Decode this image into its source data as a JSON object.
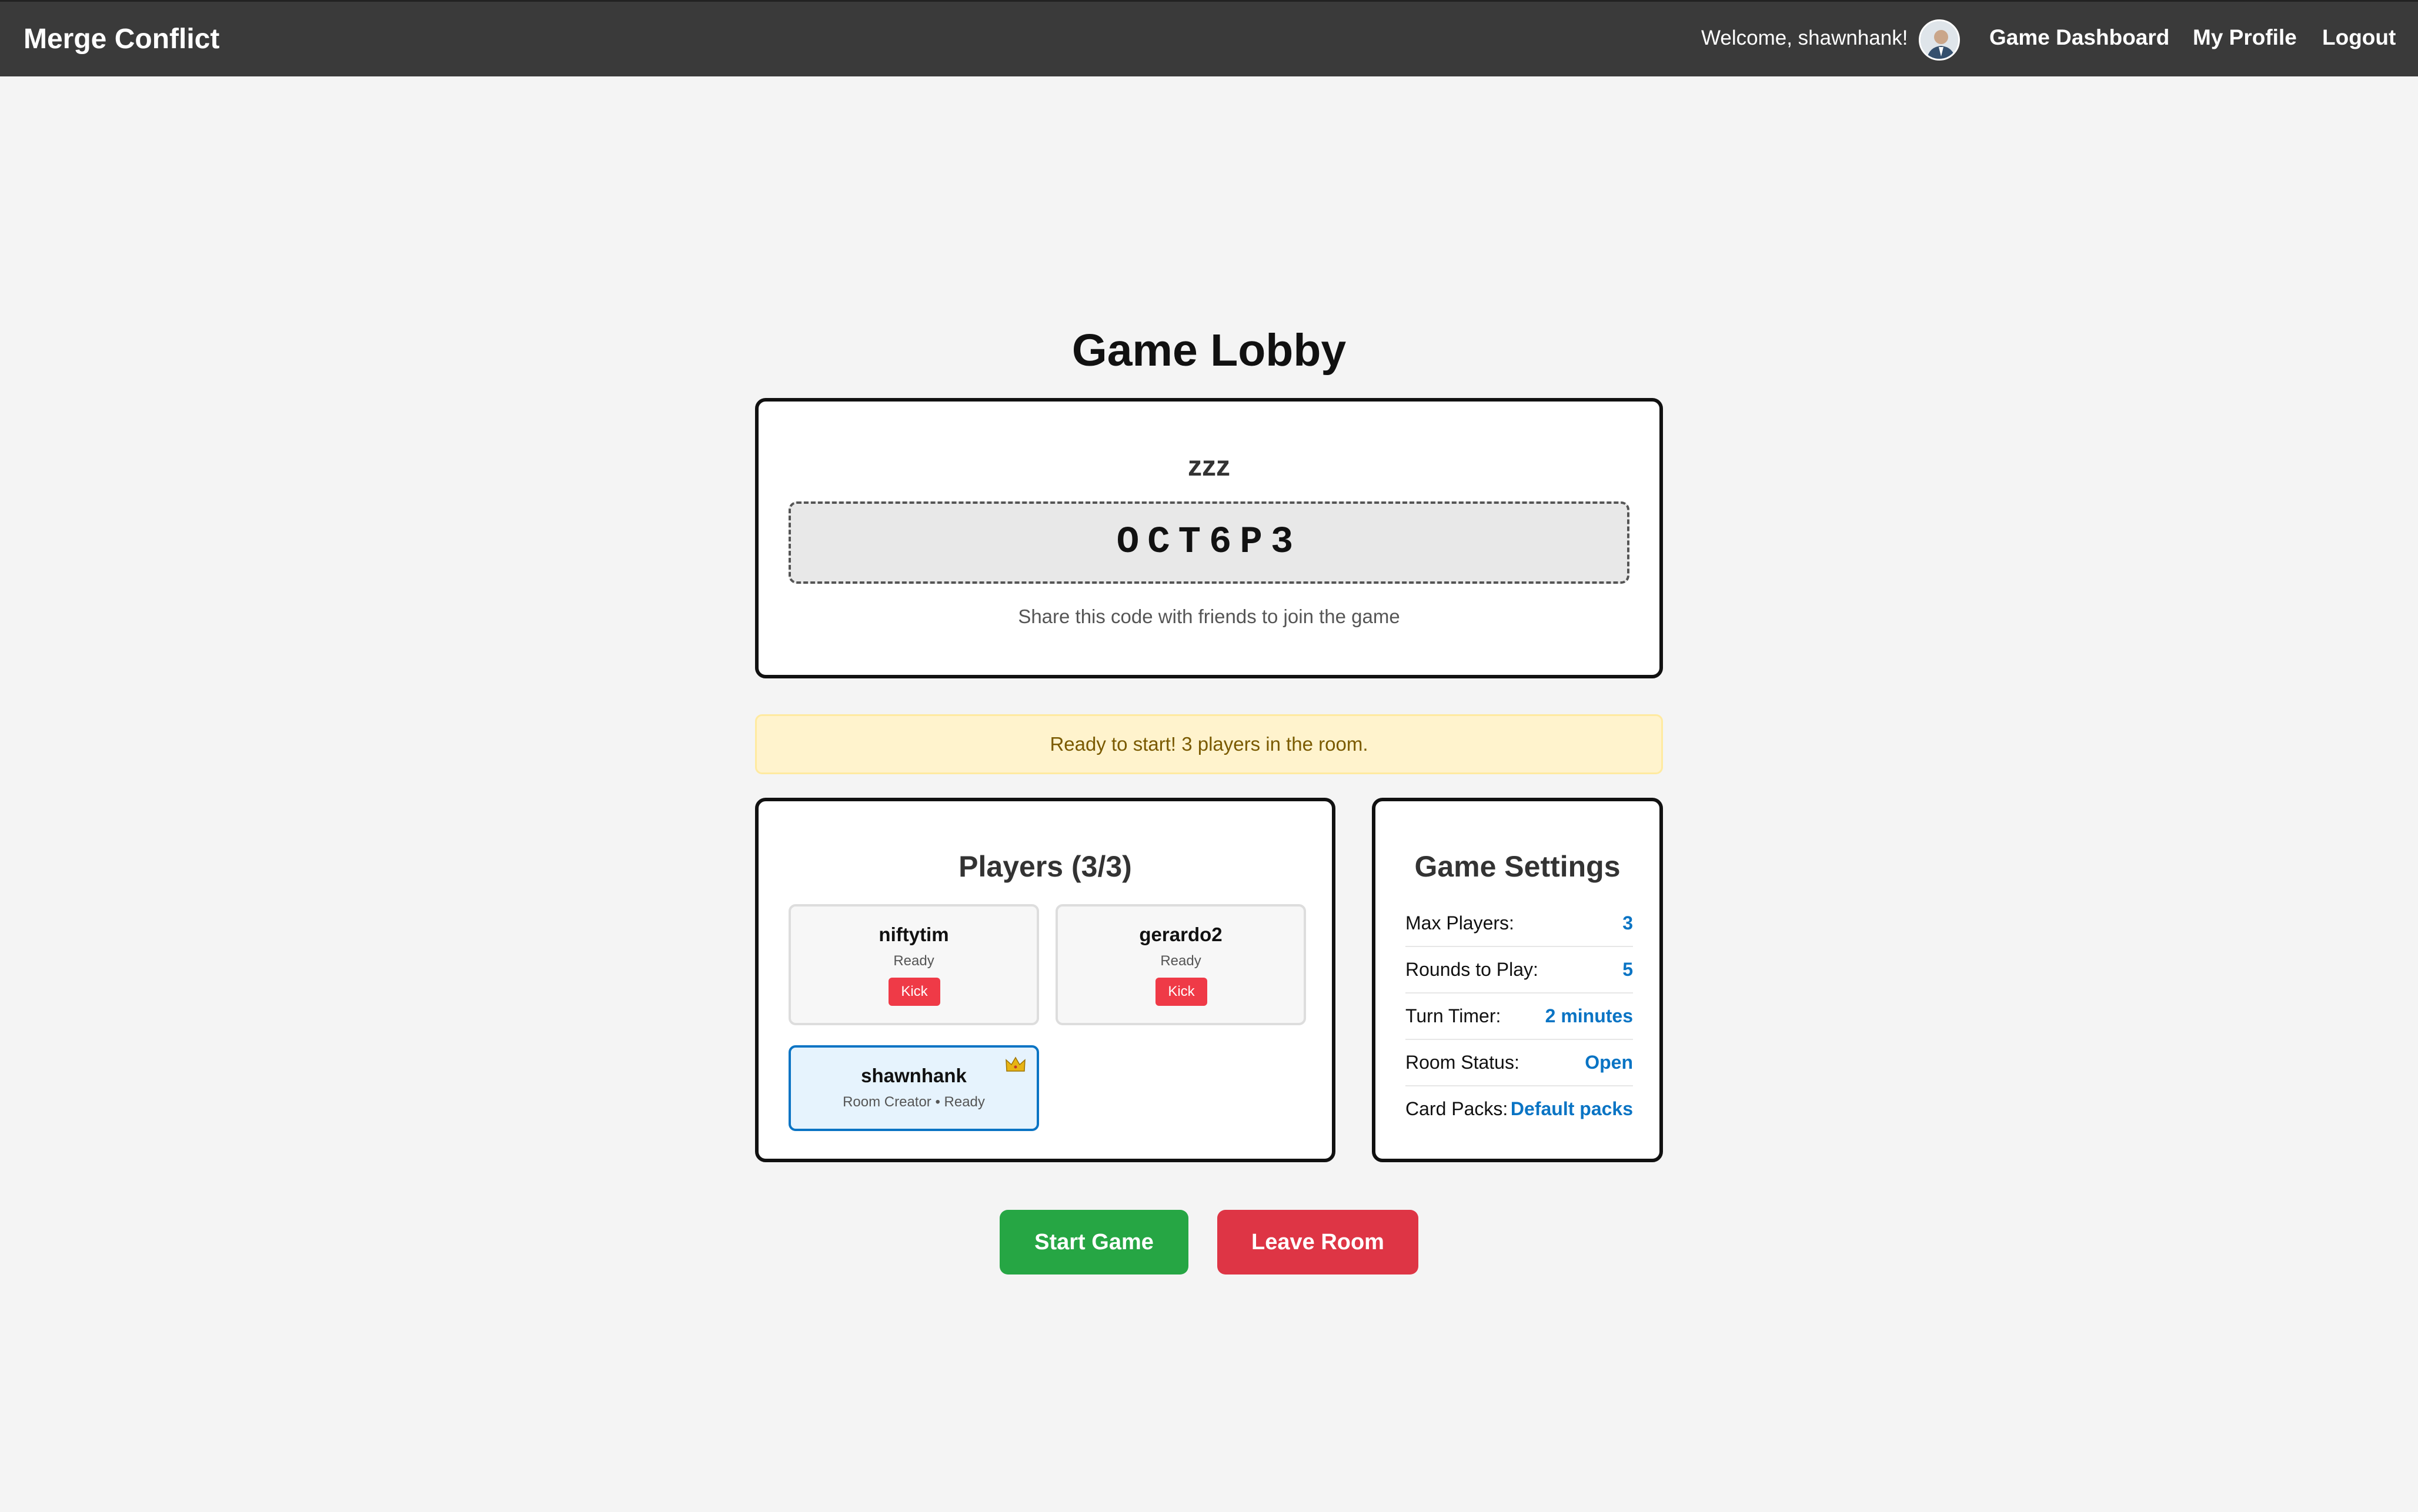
{
  "header": {
    "brand": "Merge Conflict",
    "welcome": "Welcome, shawnhank!",
    "nav": [
      "Game Dashboard",
      "My Profile",
      "Logout"
    ]
  },
  "lobby": {
    "title": "Game Lobby",
    "room_name": "zzz",
    "room_code": "OCT6P3",
    "code_hint": "Share this code with friends to join the game",
    "status_message": "Ready to start! 3 players in the room."
  },
  "players": {
    "title": "Players (3/3)",
    "list": [
      {
        "name": "niftytim",
        "status": "Ready",
        "action": "Kick"
      },
      {
        "name": "gerardo2",
        "status": "Ready",
        "action": "Kick"
      },
      {
        "name": "shawnhank",
        "status": "Room Creator • Ready"
      }
    ]
  },
  "settings": {
    "title": "Game Settings",
    "rows": [
      {
        "label": "Max Players:",
        "value": "3"
      },
      {
        "label": "Rounds to Play:",
        "value": "5"
      },
      {
        "label": "Turn Timer:",
        "value": "2 minutes"
      },
      {
        "label": "Room Status:",
        "value": "Open"
      },
      {
        "label": "Card Packs:",
        "value": "Default packs"
      }
    ]
  },
  "actions": {
    "start": "Start Game",
    "leave": "Leave Room"
  },
  "colors": {
    "topbar": "#3a3a3a",
    "accent_blue": "#0a74c4",
    "start_green": "#26a644",
    "leave_red": "#de3545",
    "kick_red": "#ef3a47",
    "alert_bg": "#fff3cd"
  }
}
